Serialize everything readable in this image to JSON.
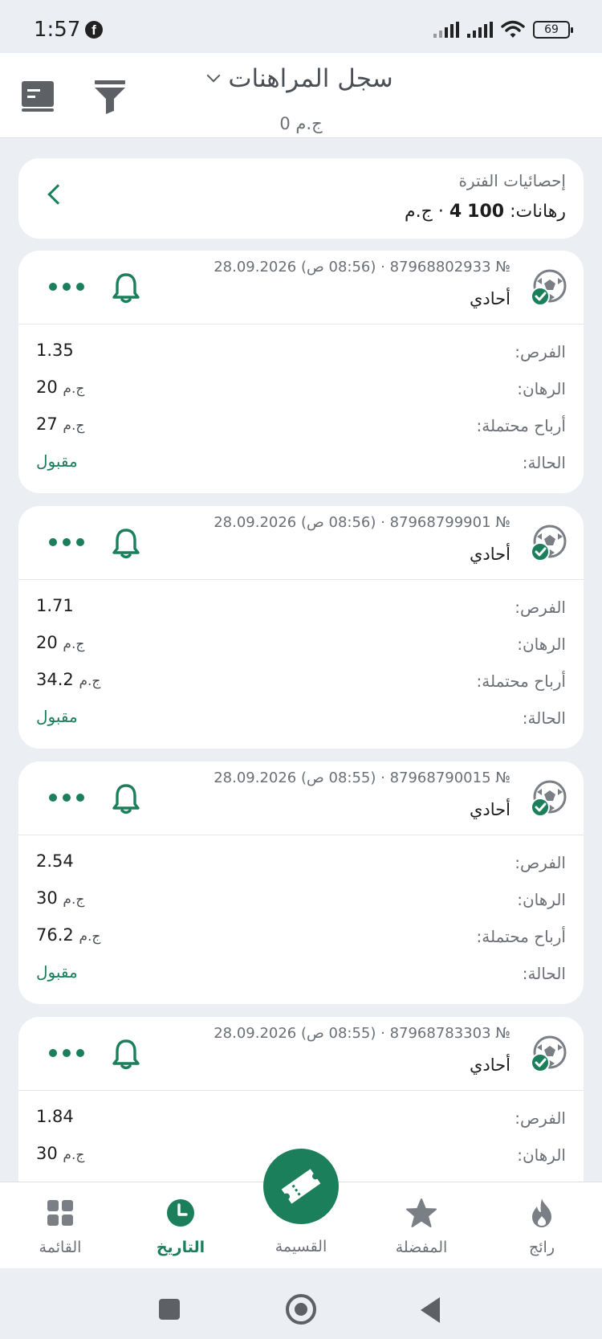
{
  "status_bar": {
    "time": "1:57",
    "battery": "69",
    "icons": [
      "facebook-icon",
      "signal-icon",
      "signal-icon",
      "wifi-icon",
      "battery-icon"
    ]
  },
  "header": {
    "title": "سجل المراهنات",
    "subtitle": "ج.م 0",
    "icons": [
      "list-icon",
      "filter-icon",
      "chevron-down-icon"
    ]
  },
  "stats": {
    "title": "إحصائيات الفترة",
    "bets_label": "رهانات:",
    "bets_count": "4",
    "amount": "100",
    "currency": "ج.م",
    "separator": "·"
  },
  "labels": {
    "odds": "الفرص:",
    "stake": "الرهان:",
    "potential": "أرباح محتملة:",
    "status": "الحالة:",
    "currency": "ج.م"
  },
  "bets": [
    {
      "meta": "№ 87968802933 · (08:56 ص) 28.09.2026",
      "type": "أحادي",
      "odds": "1.35",
      "stake": "20",
      "potential": "27",
      "status": "مقبول"
    },
    {
      "meta": "№ 87968799901 · (08:56 ص) 28.09.2026",
      "type": "أحادي",
      "odds": "1.71",
      "stake": "20",
      "potential": "34.2",
      "status": "مقبول"
    },
    {
      "meta": "№ 87968790015 · (08:55 ص) 28.09.2026",
      "type": "أحادي",
      "odds": "2.54",
      "stake": "30",
      "potential": "76.2",
      "status": "مقبول"
    },
    {
      "meta": "№ 87968783303 · (08:55 ص) 28.09.2026",
      "type": "أحادي",
      "odds": "1.84",
      "stake": "30",
      "potential": "",
      "status": ""
    }
  ],
  "nav": {
    "menu": "القائمة",
    "history": "التاريخ",
    "coupon": "القسيمة",
    "favorites": "المفضلة",
    "trending": "رائج"
  },
  "colors": {
    "accent": "#1a7f5a",
    "background": "#ebeef2",
    "card": "#ffffff",
    "muted_text": "#6b7076"
  }
}
